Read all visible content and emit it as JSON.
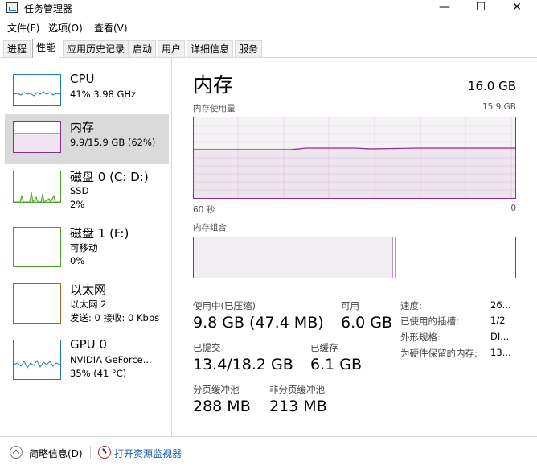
{
  "window": {
    "title": "任务管理器",
    "min": "—",
    "max": "☐",
    "close": "✕"
  },
  "menu": [
    {
      "label": "文件(F)"
    },
    {
      "label": "选项(O)"
    },
    {
      "label": "查看(V)"
    }
  ],
  "tabs": [
    {
      "label": "进程"
    },
    {
      "label": "性能"
    },
    {
      "label": "应用历史记录"
    },
    {
      "label": "启动"
    },
    {
      "label": "用户"
    },
    {
      "label": "详细信息"
    },
    {
      "label": "服务"
    }
  ],
  "active_tab": "性能",
  "resources": [
    {
      "name": "CPU",
      "sub1": "41% 3.98 GHz",
      "sub2": ""
    },
    {
      "name": "内存",
      "sub1": "9.9/15.9 GB (62%)",
      "sub2": ""
    },
    {
      "name": "磁盘 0 (C: D:)",
      "sub1": "SSD",
      "sub2": "2%"
    },
    {
      "name": "磁盘 1 (F:)",
      "sub1": "可移动",
      "sub2": "0%"
    },
    {
      "name": "以太网",
      "sub1": "以太网 2",
      "sub2": "发送: 0 接收: 0 Kbps"
    },
    {
      "name": "GPU 0",
      "sub1": "NVIDIA GeForce...",
      "sub2": "35% (41 °C)"
    }
  ],
  "colors": {
    "cpu": "#1c7ab8",
    "memory": "#8b2f8b",
    "disk": "#4da02e",
    "ethernet": "#a6682a",
    "gpu": "#1c7ab8"
  },
  "memory": {
    "title": "内存",
    "total": "16.0 GB",
    "usage_label": "内存使用量",
    "usage_max": "15.9 GB",
    "axis_left": "60 秒",
    "axis_right": "0",
    "usage_level": 0.62,
    "composition_label": "内存组合",
    "in_use_fraction": 0.62,
    "stats": {
      "in_use_label": "使用中(已压缩)",
      "in_use_value": "9.8 GB (47.4 MB)",
      "available_label": "可用",
      "available_value": "6.0 GB",
      "committed_label": "已提交",
      "committed_value": "13.4/18.2 GB",
      "cached_label": "已缓存",
      "cached_value": "6.1 GB",
      "paged_label": "分页缓冲池",
      "paged_value": "288 MB",
      "nonpaged_label": "非分页缓冲池",
      "nonpaged_value": "213 MB"
    },
    "props": [
      {
        "label": "速度:",
        "value": "26..."
      },
      {
        "label": "已使用的插槽:",
        "value": "1/2"
      },
      {
        "label": "外形规格:",
        "value": "DI..."
      },
      {
        "label": "为硬件保留的内存:",
        "value": "13..."
      }
    ]
  },
  "footer": {
    "collapse_label": "简略信息(D)",
    "monitor_label": "打开资源监视器"
  }
}
